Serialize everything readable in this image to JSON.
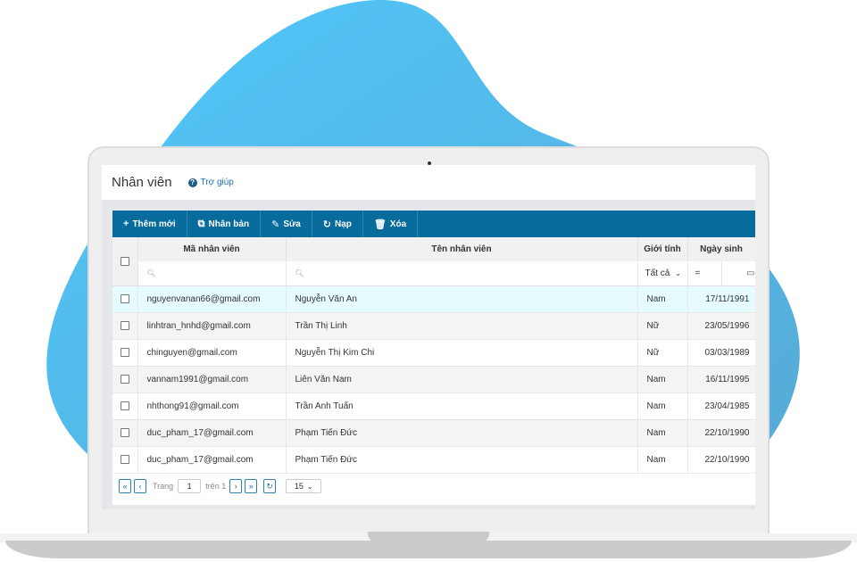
{
  "page": {
    "title": "Nhân viên",
    "help_label": "Trợ giúp",
    "help_icon": "question-circle-icon"
  },
  "toolbar": {
    "buttons": [
      {
        "label": "Thêm mới",
        "icon": "plus-icon"
      },
      {
        "label": "Nhân bản",
        "icon": "copy-icon"
      },
      {
        "label": "Sửa",
        "icon": "pencil-icon"
      },
      {
        "label": "Nạp",
        "icon": "refresh-icon"
      },
      {
        "label": "Xóa",
        "icon": "trash-icon"
      }
    ]
  },
  "grid": {
    "columns": [
      "Mã nhân viên",
      "Tên nhân viên",
      "Giới tính",
      "Ngày sinh"
    ],
    "filters": {
      "code_placeholder": "",
      "name_placeholder": "",
      "gender_value": "Tất cả",
      "date_operator": "="
    },
    "rows": [
      {
        "code": "nguyenvanan66@gmail.com",
        "name": "Nguyễn Văn An",
        "gender": "Nam",
        "dob": "17/11/1991",
        "selected": true
      },
      {
        "code": "linhtran_hnhd@gmail.com",
        "name": "Trần Thị Linh",
        "gender": "Nữ",
        "dob": "23/05/1996"
      },
      {
        "code": "chinguyen@gmail.com",
        "name": "Nguyễn Thị Kim Chi",
        "gender": "Nữ",
        "dob": "03/03/1989"
      },
      {
        "code": "vannam1991@gmail.com",
        "name": "Liên Văn Nam",
        "gender": "Nam",
        "dob": "16/11/1995"
      },
      {
        "code": "nhthong91@gmail.com",
        "name": "Trần Anh Tuấn",
        "gender": "Nam",
        "dob": "23/04/1985"
      },
      {
        "code": "duc_pham_17@gmail.com",
        "name": "Phạm Tiến Đức",
        "gender": "Nam",
        "dob": "22/10/1990"
      },
      {
        "code": "duc_pham_17@gmail.com",
        "name": "Phạm Tiến Đức",
        "gender": "Nam",
        "dob": "22/10/1990"
      }
    ]
  },
  "pager": {
    "page_label": "Trang",
    "current_page": "1",
    "of_label": "trên 1",
    "page_size": "15"
  },
  "colors": {
    "toolbar": "#076b9c",
    "blob": "#4fc3f7",
    "selected_row": "#e5fbfd"
  }
}
